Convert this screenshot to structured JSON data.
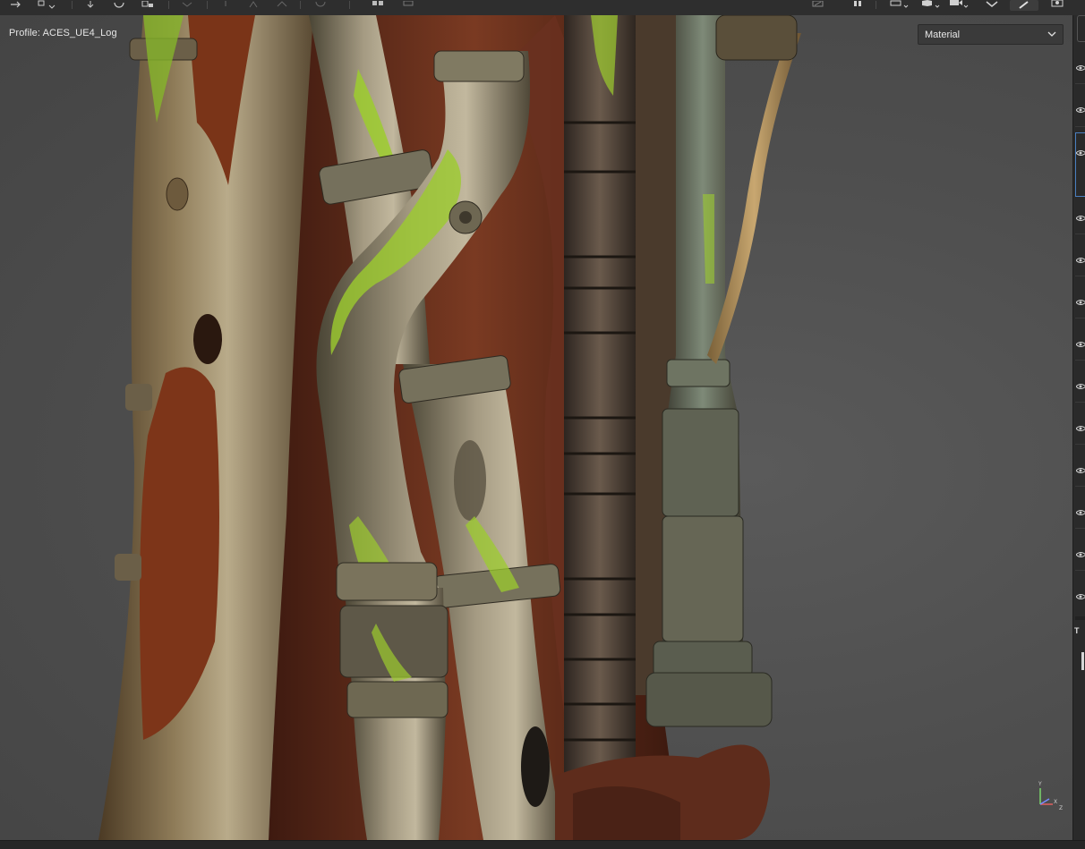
{
  "viewport": {
    "profile_label": "Profile: ACES_UE4_Log",
    "channel_select": {
      "selected": "Material"
    },
    "axis": {
      "y": "Y",
      "x": "X",
      "z": "Z"
    }
  },
  "toolbar": {
    "icons": [
      "transform-icon",
      "select-icon",
      "move-icon",
      "rotate-icon",
      "scale-icon",
      "symmetry-icon",
      "tool-icon",
      "tool-icon-2",
      "tool-icon-3",
      "tool-icon-4",
      "tool-icon-5",
      "pause-icon",
      "camera-icon",
      "cube-icon",
      "video-icon",
      "bake-icon",
      "paint-brush-icon",
      "screenshot-icon"
    ]
  },
  "right_panel": {
    "section_label": "T"
  },
  "colors": {
    "background": "#4f4f4f",
    "accent_selection": "#4a7fc0",
    "moss": "#9ccc2e"
  }
}
